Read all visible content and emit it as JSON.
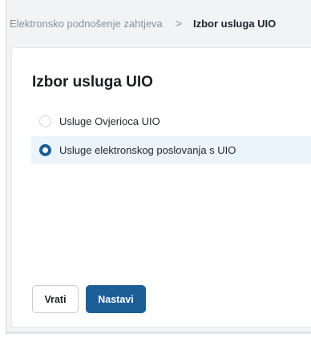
{
  "breadcrumb": {
    "parent": "Elektronsko podnošenje zahtjeva",
    "separator": ">",
    "current": "Izbor usluga UIO"
  },
  "page": {
    "title": "Izbor usluga UIO"
  },
  "options": [
    {
      "label": "Usluge Ovjerioca UIO",
      "selected": false
    },
    {
      "label": "Usluge elektronskog poslovanja s UIO",
      "selected": true
    }
  ],
  "actions": {
    "back_label": "Vrati",
    "next_label": "Nastavi"
  },
  "colors": {
    "primary": "#1c5e96",
    "selected_row": "#eaf4fa",
    "page_bg": "#f1f3f5"
  }
}
